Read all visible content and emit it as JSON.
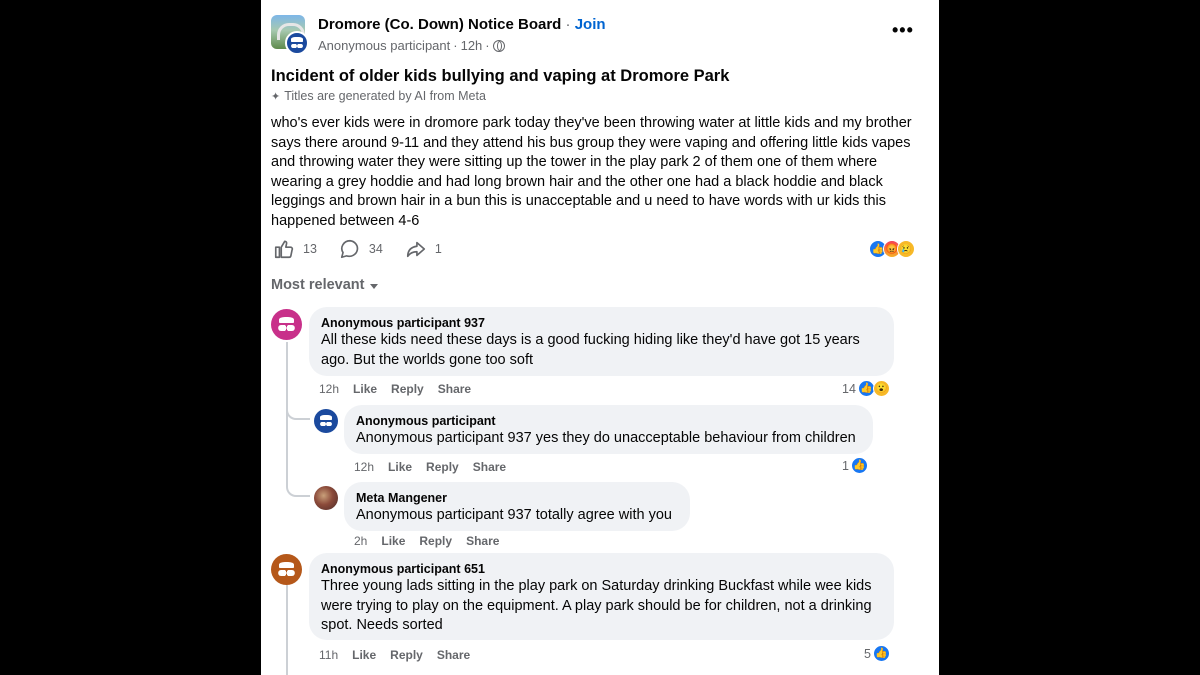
{
  "group": {
    "name": "Dromore (Co. Down) Notice Board",
    "separator": "·",
    "join_label": "Join",
    "author": "Anonymous participant",
    "time": "12h",
    "more_label": "•••"
  },
  "post": {
    "title": "Incident of older kids bullying and vaping at Dromore Park",
    "ai_note": "Titles are generated by AI from Meta",
    "body": "who's ever kids were in dromore park today they've been throwing water at little kids and my brother says there around 9-11 and they attend his bus group they were vaping and offering little kids vapes and throwing water they were sitting up the tower in the play park 2 of them one of them where wearing a grey hoddie and had long brown hair and the other one had a black hoddie and black leggings and brown hair in a bun this is unacceptable and u need to have words with ur kids this happened between 4-6",
    "likes": "13",
    "comments": "34",
    "shares": "1"
  },
  "sort_label": "Most relevant",
  "comments": [
    {
      "name": "Anonymous participant 937",
      "text": "All these kids need these days is a good fucking hiding like they'd have got 15 years ago. But the worlds gone too soft",
      "time": "12h",
      "like": "Like",
      "reply": "Reply",
      "share": "Share",
      "reactions": "14"
    },
    {
      "name": "Anonymous participant",
      "text": "Anonymous participant 937 yes they do unacceptable behaviour from children",
      "time": "12h",
      "like": "Like",
      "reply": "Reply",
      "share": "Share",
      "reactions": "1"
    },
    {
      "name": "Meta Mangener",
      "text": "Anonymous participant 937 totally agree with you",
      "time": "2h",
      "like": "Like",
      "reply": "Reply",
      "share": "Share"
    },
    {
      "name": "Anonymous participant 651",
      "text": "Three young lads sitting in the play park on Saturday drinking Buckfast while wee kids were trying to play on the equipment. A play park should be for children, not a drinking spot. Needs sorted",
      "time": "11h",
      "like": "Like",
      "reply": "Reply",
      "share": "Share",
      "reactions": "5"
    }
  ],
  "colors": {
    "accent": "#0064d1",
    "like_blue": "#1877f2",
    "bubble": "#f0f2f5",
    "avatar_pink": "#c8308a",
    "avatar_navy": "#1b4a9e",
    "avatar_orange": "#b5581a"
  }
}
